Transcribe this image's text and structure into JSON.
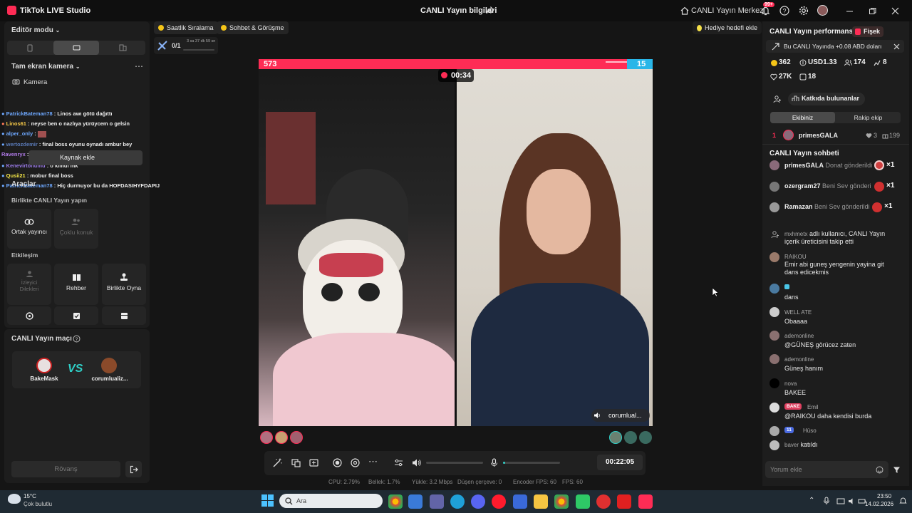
{
  "app": {
    "name": "TikTok LIVE Studio",
    "window_title": "CANLI Yayın bilgileri",
    "center_btn": "CANLI Yayın Merkezi",
    "notif_badge": "99+"
  },
  "left": {
    "editor_mode": "Editör modu",
    "scene": "Tam ekran kamera",
    "camera": "Kamera",
    "tooltip": "Kaynak ekle",
    "tools_title": "Araçlar",
    "together_title": "Birlikte CANLI Yayın yapın",
    "cohost": "Ortak yayıncı",
    "multi_guest": "Çoklu konuk",
    "interaction_title": "Etkileşim",
    "viewer_wishes": "İzleyici Dilekleri",
    "guide": "Rehber",
    "play_together": "Birlikte Oyna",
    "chat": [
      {
        "name": "PatrickBateman78",
        "text": " : Linos awı götü dağıttı"
      },
      {
        "name": "Linos61",
        "text": " : neyse ben o nazlıya yürüycem o gelsin"
      },
      {
        "name": "alper_only",
        "text": " :"
      },
      {
        "name": "wertozdemir",
        "text": " : final boss oyunu oynadı ambur bey"
      },
      {
        "name": "Ravenryx",
        "text": " :"
      },
      {
        "name": "Kenevirtohumu",
        "text": " : o kimdi mk"
      },
      {
        "name": "Qusii21",
        "text": " : mobur final boss"
      },
      {
        "name": "PatrickBateman78",
        "text": " : Hiç durmuyor bu da HOFDASIHYFDAPIJ"
      }
    ],
    "match_title": "CANLI Yayın maçı",
    "player1": "BakeMask",
    "vs": "VS",
    "player2": "corumlualiz...",
    "rematch": "Rövanş"
  },
  "top_chips": {
    "hourly": "Saatlik Sıralama",
    "chat_meet": "Sohbet & Görüşme",
    "gift_goal": "Hediye hedefi ekle",
    "goal_count": "0/1",
    "goal_time": "3 sa 37 dk 59 sn"
  },
  "battle": {
    "score_left": "573",
    "score_right": "15",
    "timer": "00:34",
    "right_name": "corumlual..."
  },
  "controls": {
    "timer": "00:22:05"
  },
  "statusbar": {
    "cpu": "CPU: 2.79%",
    "mem": "Bellek: 1.7%",
    "upload": "Yükle: 3.2 Mbps",
    "dropped": "Düşen çerçeve: 0",
    "encoder": "Encoder FPS: 60",
    "fps": "FPS: 60"
  },
  "right": {
    "perf_title": "CANLI Yayın performansı",
    "tag": "Fişek",
    "notice": "Bu CANLI Yayında +0.08 ABD doları",
    "coins": "362",
    "usd": "USD1.33",
    "viewers": "174",
    "gifters": "8",
    "likes": "27K",
    "shares": "18",
    "contributors": "Katkıda bulunanlar",
    "tab_team": "Ekibiniz",
    "tab_rival": "Rakip ekip",
    "rank_no": "1",
    "rank_name": "primesGALA",
    "rank_likes": "3",
    "rank_score": "199",
    "chat_title": "CANLI Yayın sohbeti",
    "gifts": [
      {
        "name": "primesGALA",
        "text": "Donat gönderildi",
        "count": "×1"
      },
      {
        "name": "ozergram27",
        "text": "Beni Sev gönderi",
        "count": "×1"
      },
      {
        "name": "Ramazan",
        "text": "Beni Sev gönderildi",
        "count": "×1"
      }
    ],
    "messages": [
      {
        "user": "mxhmetx",
        "text": "adlı kullanıcı, CANLI Yayın içerik üreticisini takip etti"
      },
      {
        "user": "RAIKOU",
        "text": "Emir abi guneş yengenin yayina git dans edicekmis"
      },
      {
        "user": "",
        "text": "dans"
      },
      {
        "user": "WELL ATE",
        "text": "Obaaaa"
      },
      {
        "user": "ademonline",
        "text": "@GÜNEŞ görücez zaten"
      },
      {
        "user": "ademonline",
        "text": "Güneş hanım"
      },
      {
        "user": "nova",
        "text": "BAKEE"
      },
      {
        "user": "Emil",
        "text": "@RAIKOU daha kendisi burda"
      },
      {
        "user": "Hüso",
        "text": ""
      },
      {
        "user": "baver",
        "text": "katıldı"
      }
    ],
    "badge_bake": "BAKE",
    "badge_lvl": "11",
    "comment_placeholder": "Yorum ekle"
  },
  "taskbar": {
    "temp": "15°C",
    "weather": "Çok bulutlu",
    "search": "Ara",
    "time": "23:50",
    "date": "14.02.2026"
  },
  "colors": {
    "accent": "#fe2c55",
    "blue_team": "#4ac6e8",
    "bg": "#151515"
  }
}
